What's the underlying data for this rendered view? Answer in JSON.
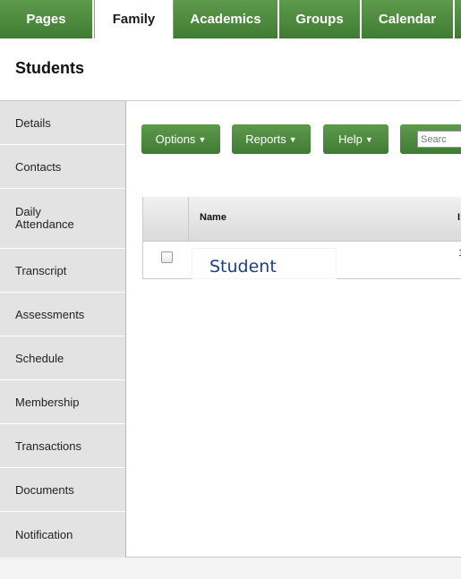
{
  "tabs": [
    {
      "label": "Pages",
      "active": false
    },
    {
      "label": "Family",
      "active": true
    },
    {
      "label": "Academics",
      "active": false
    },
    {
      "label": "Groups",
      "active": false
    },
    {
      "label": "Calendar",
      "active": false
    }
  ],
  "page_title": "Students",
  "sidebar": {
    "items": [
      {
        "label": "Details"
      },
      {
        "label": "Contacts"
      },
      {
        "label": "Daily\nAttendance"
      },
      {
        "label": "Transcript"
      },
      {
        "label": "Assessments"
      },
      {
        "label": "Schedule"
      },
      {
        "label": "Membership"
      },
      {
        "label": "Transactions"
      },
      {
        "label": "Documents"
      },
      {
        "label": "Notification"
      }
    ]
  },
  "toolbar": {
    "options_label": "Options",
    "reports_label": "Reports",
    "help_label": "Help",
    "search_placeholder": "Searc"
  },
  "table": {
    "columns": [
      "Name",
      "I"
    ],
    "rows": [
      {
        "name": "Student",
        "next": "1"
      }
    ]
  },
  "colors": {
    "accent_green": "#4a8a3c",
    "link_blue": "#1f3e88",
    "sidebar_bg": "#e3e3e3"
  }
}
